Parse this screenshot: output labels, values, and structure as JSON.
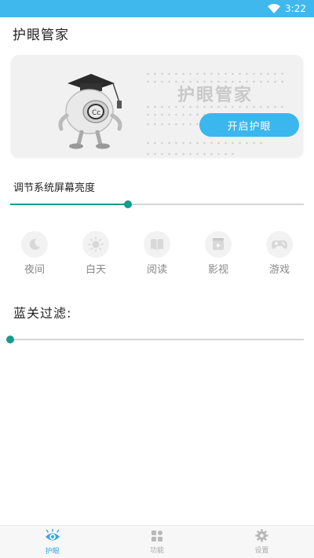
{
  "status_bar": {
    "time": "3:22",
    "icon": "wifi-icon"
  },
  "app": {
    "title": "护眼管家"
  },
  "hero": {
    "brand_text": "护眼管家",
    "mascot_icon": "graduate-mascot-icon",
    "start_button_label": "开启护眼"
  },
  "brightness": {
    "label": "调节系统屏幕亮度",
    "value": 0.4
  },
  "modes": [
    {
      "label": "夜间",
      "icon": "moon-icon"
    },
    {
      "label": "白天",
      "icon": "sun-icon"
    },
    {
      "label": "阅读",
      "icon": "book-icon"
    },
    {
      "label": "影视",
      "icon": "film-icon"
    },
    {
      "label": "游戏",
      "icon": "gamepad-icon"
    }
  ],
  "blue_filter": {
    "label": "蓝关过滤:",
    "value": 0.0
  },
  "tabs": [
    {
      "label": "护眼",
      "icon": "eye-icon",
      "active": true
    },
    {
      "label": "功能",
      "icon": "grid-icon",
      "active": false
    },
    {
      "label": "设置",
      "icon": "gear-icon",
      "active": false
    }
  ],
  "colors": {
    "accent": "#3cb6ee",
    "slider": "#169b8e",
    "status_bar": "#3fb8ee"
  }
}
